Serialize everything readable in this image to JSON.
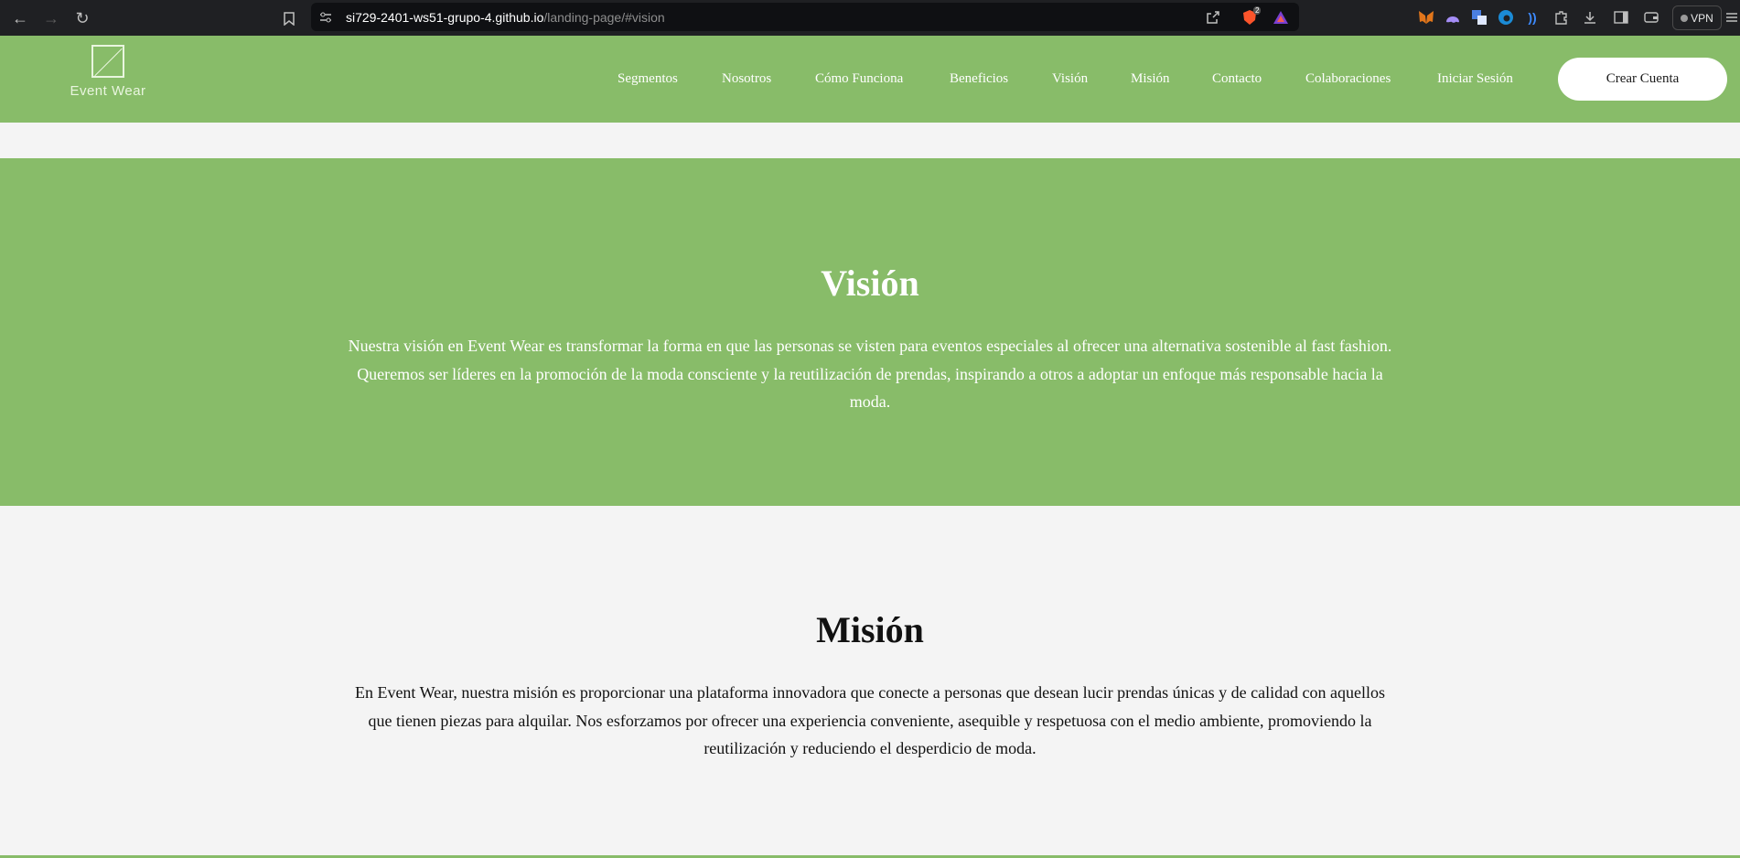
{
  "browser": {
    "url_host": "si729-2401-ws51-grupo-4.github.io",
    "url_path": "/landing-page/#vision",
    "shield_badge": "2",
    "vpn_label": "VPN"
  },
  "header": {
    "logo_text": "Event Wear",
    "nav": [
      {
        "label": "Segmentos"
      },
      {
        "label": "Nosotros"
      },
      {
        "label": "Cómo Funciona"
      },
      {
        "label": "Beneficios"
      },
      {
        "label": "Visión"
      },
      {
        "label": "Misión"
      },
      {
        "label": "Contacto"
      },
      {
        "label": "Colaboraciones"
      },
      {
        "label": "Iniciar Sesión"
      }
    ],
    "cta_label": "Crear Cuenta"
  },
  "vision": {
    "title": "Visión",
    "text": "Nuestra visión en Event Wear es transformar la forma en que las personas se visten para eventos especiales al ofrecer una alternativa sostenible al fast fashion. Queremos ser líderes en la promoción de la moda consciente y la reutilización de prendas, inspirando a otros a adoptar un enfoque más responsable hacia la moda."
  },
  "mision": {
    "title": "Misión",
    "text": "En Event Wear, nuestra misión es proporcionar una plataforma innovadora que conecte a personas que desean lucir prendas únicas y de calidad con aquellos que tienen piezas para alquilar. Nos esforzamos por ofrecer una experiencia conveniente, asequible y respetuosa con el medio ambiente, promoviendo la reutilización y reduciendo el desperdicio de moda."
  },
  "colors": {
    "brand_green": "#88bc69",
    "page_bg": "#f4f4f4",
    "chrome_bg": "#1f2023"
  }
}
